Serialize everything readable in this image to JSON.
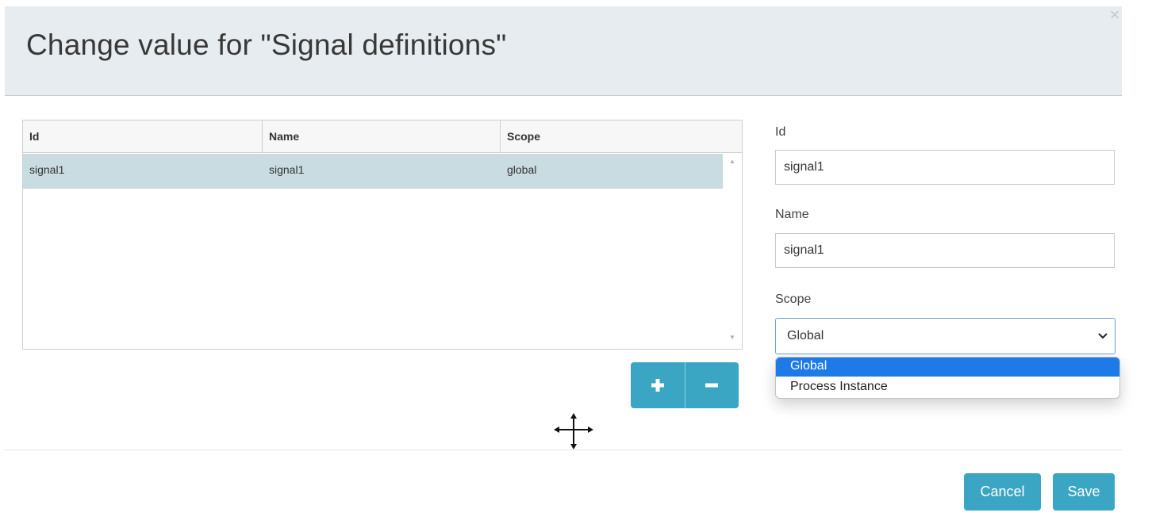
{
  "dialog": {
    "title": "Change value for \"Signal definitions\"",
    "close_glyph": "×"
  },
  "grid": {
    "columns": [
      "Id",
      "Name",
      "Scope"
    ],
    "rows": [
      {
        "id": "signal1",
        "name": "signal1",
        "scope": "global",
        "selected": true
      }
    ]
  },
  "row_buttons": {
    "add_icon": "plus-icon",
    "remove_icon": "minus-icon"
  },
  "form": {
    "id_label": "Id",
    "id_value": "signal1",
    "name_label": "Name",
    "name_value": "signal1",
    "scope_label": "Scope",
    "scope_value": "Global",
    "scope_options": [
      "Global",
      "Process Instance"
    ],
    "scope_highlighted": "Global"
  },
  "footer": {
    "cancel_label": "Cancel",
    "save_label": "Save"
  },
  "colors": {
    "accent": "#3aa6c4",
    "header_bg": "#e6ecf0",
    "selected_row": "#c8dce1",
    "option_highlight": "#1e7ae6"
  }
}
